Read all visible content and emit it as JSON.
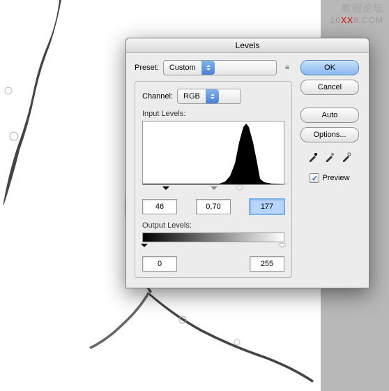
{
  "watermark": {
    "line1": "教程论坛",
    "prefix": "16",
    "mid": "XX",
    "suffix": "8.COM"
  },
  "dialog": {
    "title": "Levels",
    "preset": {
      "label": "Preset:",
      "value": "Custom"
    },
    "channel": {
      "label": "Channel:",
      "value": "RGB"
    },
    "input": {
      "label": "Input Levels:",
      "shadow": "46",
      "mid": "0,70",
      "highlight": "177"
    },
    "output": {
      "label": "Output Levels:",
      "low": "0",
      "high": "255"
    },
    "buttons": {
      "ok": "OK",
      "cancel": "Cancel",
      "auto": "Auto",
      "options": "Options..."
    },
    "preview": {
      "label": "Preview",
      "checked": true
    }
  }
}
